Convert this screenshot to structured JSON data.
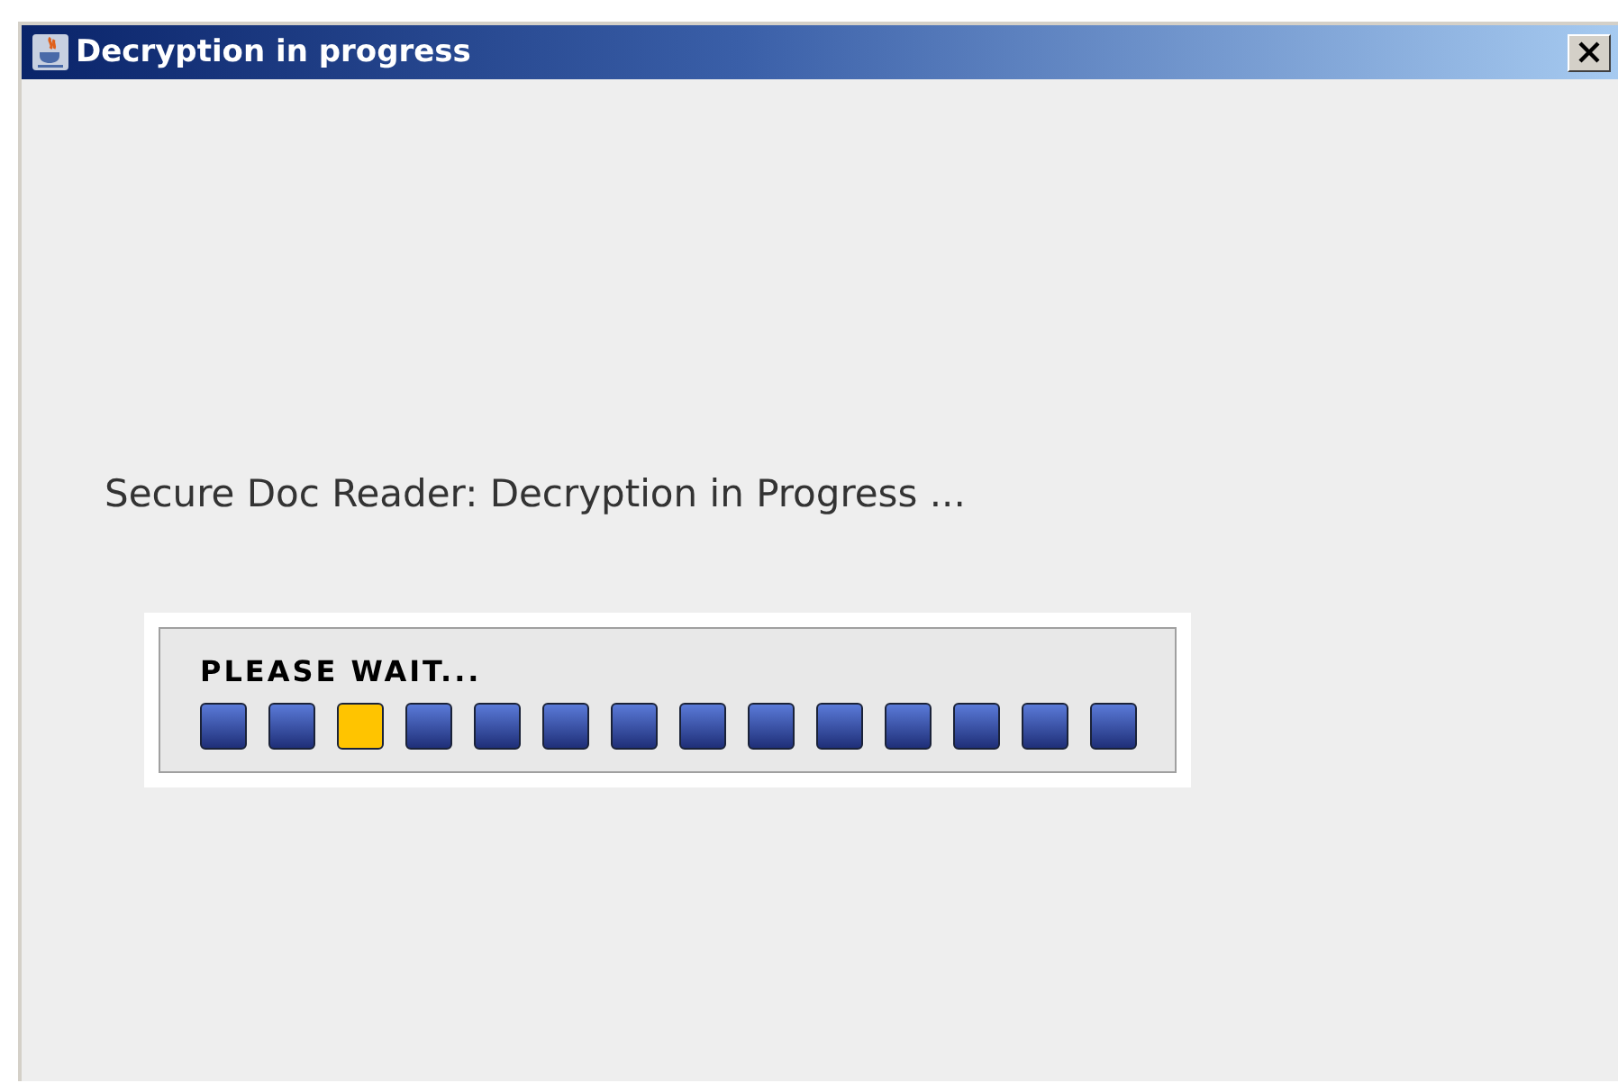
{
  "window": {
    "title": "Decryption in progress"
  },
  "message": "Secure Doc Reader: Decryption in Progress ...",
  "progress": {
    "label": "PLEASE WAIT...",
    "blocks": [
      {
        "lit": false
      },
      {
        "lit": false
      },
      {
        "lit": true
      },
      {
        "lit": false
      },
      {
        "lit": false
      },
      {
        "lit": false
      },
      {
        "lit": false
      },
      {
        "lit": false
      },
      {
        "lit": false
      },
      {
        "lit": false
      },
      {
        "lit": false
      },
      {
        "lit": false
      },
      {
        "lit": false
      },
      {
        "lit": false
      }
    ]
  }
}
